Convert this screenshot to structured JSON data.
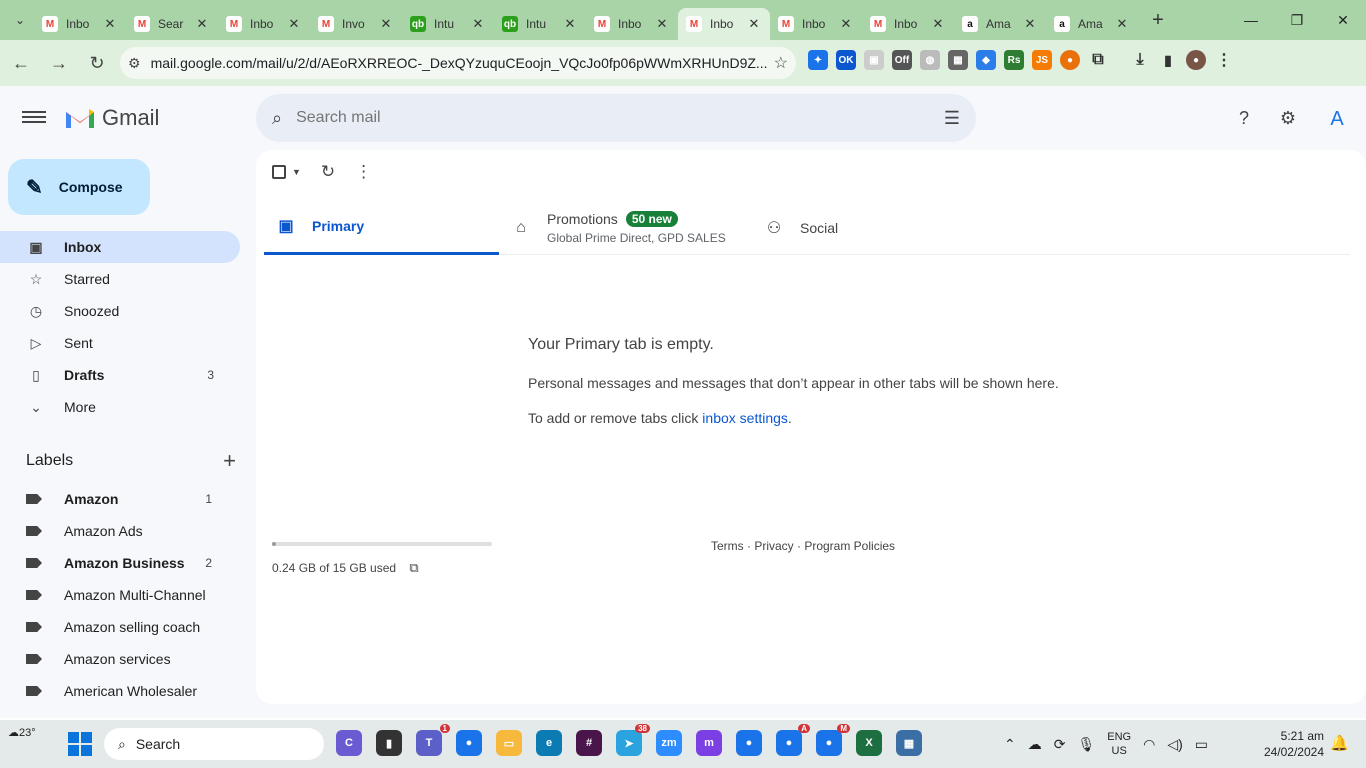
{
  "browser": {
    "tabs": [
      {
        "title": "Inbo",
        "icon": "gmail-icon",
        "active": false
      },
      {
        "title": "Sear",
        "icon": "gmail-icon",
        "active": false
      },
      {
        "title": "Inbo",
        "icon": "gmail-icon",
        "active": false
      },
      {
        "title": "Invo",
        "icon": "gmail-icon",
        "active": false
      },
      {
        "title": "Intu",
        "icon": "quickbooks-icon",
        "active": false
      },
      {
        "title": "Intu",
        "icon": "quickbooks-icon",
        "active": false
      },
      {
        "title": "Inbo",
        "icon": "gmail-icon",
        "active": false
      },
      {
        "title": "Inbo",
        "icon": "gmail-icon",
        "active": true
      },
      {
        "title": "Inbo",
        "icon": "gmail-icon",
        "active": false
      },
      {
        "title": "Inbo",
        "icon": "gmail-icon",
        "active": false
      },
      {
        "title": "Ama",
        "icon": "amazon-icon",
        "active": false
      },
      {
        "title": "Ama",
        "icon": "amazon-icon",
        "active": false
      }
    ],
    "url": "mail.google.com/mail/u/2/d/AEoRXRREOC-_DexQYzuquCEoojn_VQcJo0fp06pWWmXRHUnD9Z...",
    "colors": {
      "tabbar": "#a8d4a8",
      "toolbar": "#dff0df"
    }
  },
  "gmail": {
    "app_name": "Gmail",
    "search_placeholder": "Search mail",
    "avatar_letter": "A",
    "compose_label": "Compose",
    "nav": [
      {
        "label": "Inbox",
        "icon": "inbox-icon",
        "count": "",
        "active": true
      },
      {
        "label": "Starred",
        "icon": "star-icon",
        "count": "",
        "active": false
      },
      {
        "label": "Snoozed",
        "icon": "clock-icon",
        "count": "",
        "active": false
      },
      {
        "label": "Sent",
        "icon": "send-icon",
        "count": "",
        "active": false
      },
      {
        "label": "Drafts",
        "icon": "draft-icon",
        "count": "3",
        "active": false,
        "bold": true
      },
      {
        "label": "More",
        "icon": "chevron-down-icon",
        "count": "",
        "active": false
      }
    ],
    "labels_title": "Labels",
    "labels": [
      {
        "label": "Amazon",
        "count": "1",
        "bold": true
      },
      {
        "label": "Amazon Ads",
        "count": "",
        "bold": false
      },
      {
        "label": "Amazon Business",
        "count": "2",
        "bold": true
      },
      {
        "label": "Amazon Multi-Channel",
        "count": "",
        "bold": false
      },
      {
        "label": "Amazon selling coach",
        "count": "",
        "bold": false
      },
      {
        "label": "Amazon services",
        "count": "",
        "bold": false
      },
      {
        "label": "American Wholesaler",
        "count": "",
        "bold": false
      }
    ],
    "categories": [
      {
        "label": "Primary",
        "icon": "inbox-icon",
        "active": true,
        "badge": "",
        "sub": ""
      },
      {
        "label": "Promotions",
        "icon": "tag-icon",
        "active": false,
        "badge": "50 new",
        "sub": "Global Prime Direct, GPD SALES"
      },
      {
        "label": "Social",
        "icon": "people-icon",
        "active": false,
        "badge": "",
        "sub": ""
      }
    ],
    "empty": {
      "heading": "Your Primary tab is empty.",
      "line1": "Personal messages and messages that don’t appear in other tabs will be shown here.",
      "line2_prefix": "To add or remove tabs click ",
      "line2_link": "inbox settings",
      "line2_suffix": "."
    },
    "storage": {
      "text": "0.24 GB of 15 GB used",
      "fraction": 0.016
    },
    "footer": "Terms · Privacy · Program Policies"
  },
  "taskbar": {
    "weather": "23°",
    "search_label": "Search",
    "apps": [
      {
        "name": "copilot",
        "badge": ""
      },
      {
        "name": "file-explorer",
        "badge": ""
      },
      {
        "name": "teams",
        "badge": "1"
      },
      {
        "name": "chrome",
        "badge": ""
      },
      {
        "name": "folder",
        "badge": ""
      },
      {
        "name": "edge",
        "badge": ""
      },
      {
        "name": "slack",
        "badge": ""
      },
      {
        "name": "telegram",
        "badge": "38"
      },
      {
        "name": "zoom",
        "badge": ""
      },
      {
        "name": "messenger",
        "badge": ""
      },
      {
        "name": "chrome",
        "badge": ""
      },
      {
        "name": "chrome",
        "badge": "A"
      },
      {
        "name": "chrome",
        "badge": "M"
      },
      {
        "name": "excel",
        "badge": ""
      },
      {
        "name": "calculator",
        "badge": ""
      }
    ],
    "lang_top": "ENG",
    "lang_bottom": "US",
    "time": "5:21 am",
    "date": "24/02/2024"
  }
}
